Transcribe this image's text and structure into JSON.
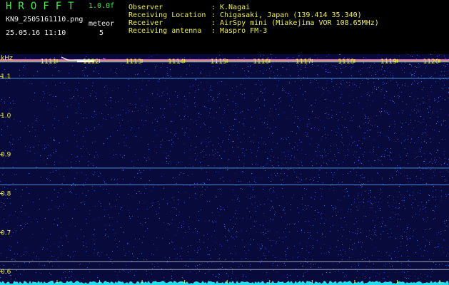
{
  "header": {
    "app_title": "HROFFT",
    "version": "1.0.0f",
    "file_name": "KN9_2505161110.png",
    "date_time": "25.05.16 11:10",
    "meteor_label": "meteor",
    "meteor_count": "5"
  },
  "station_info": [
    {
      "label": "Observer",
      "value": "K.Nagai"
    },
    {
      "label": "Receiving Location",
      "value": "Chigasaki, Japan (139.414 35.340)"
    },
    {
      "label": "Receiver",
      "value": "AirSpy mini (Miakejima VOR 108.65MHz)"
    },
    {
      "label": "Receiving antenna",
      "value": "Maspro FM-3"
    }
  ],
  "info_separator": ":",
  "spectrogram": {
    "axis_unit": "kHz",
    "y_axis_ticks": [
      {
        "label": "1.1",
        "value": 1.1
      },
      {
        "label": "1.0",
        "value": 1.0
      },
      {
        "label": "0.9",
        "value": 0.9
      },
      {
        "label": "0.8",
        "value": 0.8
      },
      {
        "label": "0.7",
        "value": 0.7
      },
      {
        "label": "0.6",
        "value": 0.6
      }
    ],
    "time_markers": [
      "1111",
      "1112",
      "1113",
      "1114",
      "1115",
      "1116",
      "1117",
      "1118",
      "1119",
      "1120"
    ],
    "y_range": [
      0.58,
      1.157
    ],
    "carrier_frequency": 1.14,
    "steady_lines_khz": [
      1.095,
      0.865,
      0.822,
      0.625,
      0.605
    ],
    "colors": {
      "background": "#070a3a",
      "axis_text": "#f0f040",
      "carrier": "#ff60c8",
      "steady_line": "#5ab0ff",
      "noise_floor": "#20e0f0"
    }
  }
}
